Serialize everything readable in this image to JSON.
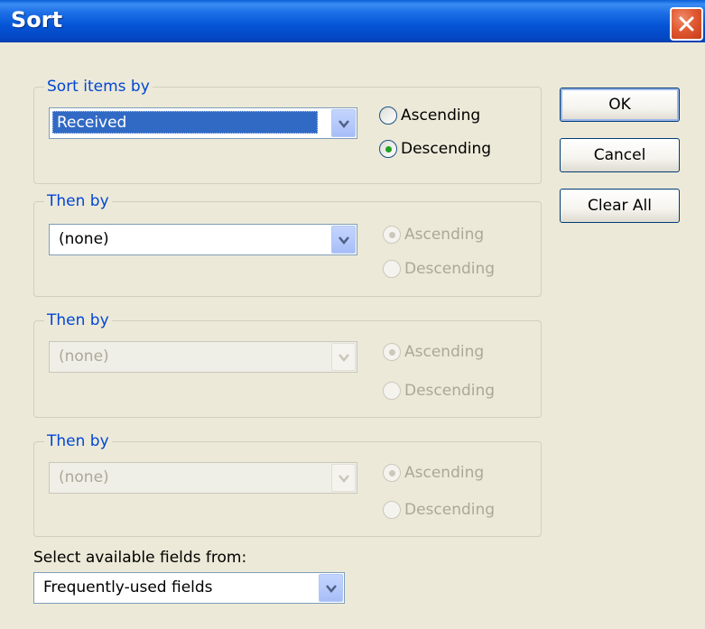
{
  "window": {
    "title": "Sort"
  },
  "sort_group": {
    "legend": "Sort items by",
    "field_value": "Received",
    "ascending_label": "Ascending",
    "descending_label": "Descending",
    "selected": "descending"
  },
  "then_group_1": {
    "legend": "Then by",
    "field_value": "(none)",
    "ascending_label": "Ascending",
    "descending_label": "Descending"
  },
  "then_group_2": {
    "legend": "Then by",
    "field_value": "(none)",
    "ascending_label": "Ascending",
    "descending_label": "Descending"
  },
  "then_group_3": {
    "legend": "Then by",
    "field_value": "(none)",
    "ascending_label": "Ascending",
    "descending_label": "Descending"
  },
  "buttons": {
    "ok": "OK",
    "cancel": "Cancel",
    "clear_all": "Clear All"
  },
  "footer": {
    "label": "Select available fields from:",
    "field_value": "Frequently-used fields"
  },
  "icons": {
    "close": "close-icon",
    "dropdown": "chevron-down-icon"
  },
  "colors": {
    "titlebar": "#0554d6",
    "selection": "#316ac5",
    "legend_text": "#0046d5",
    "radio_dot": "#21a121",
    "close_button": "#e15a32"
  }
}
